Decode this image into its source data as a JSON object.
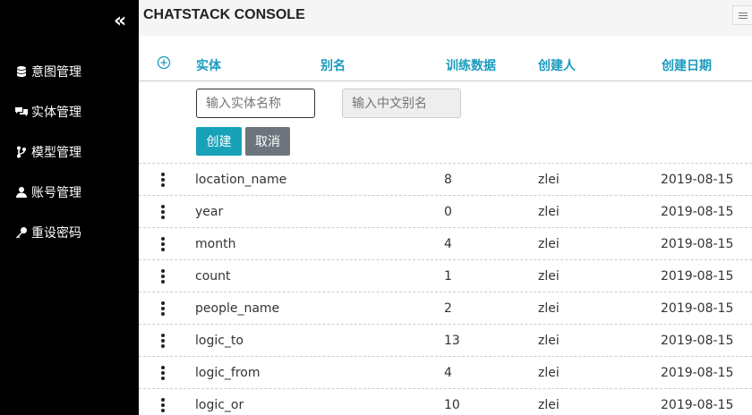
{
  "app": {
    "title": "CHATSTACK CONSOLE"
  },
  "sidebar": {
    "collapse_icon": "double-chevron-left-icon",
    "items": [
      {
        "label": "意图管理",
        "icon": "database-icon"
      },
      {
        "label": "实体管理",
        "icon": "chat-icon"
      },
      {
        "label": "模型管理",
        "icon": "branch-icon"
      },
      {
        "label": "账号管理",
        "icon": "user-icon"
      },
      {
        "label": "重设密码",
        "icon": "key-icon"
      }
    ]
  },
  "table": {
    "headers": [
      "实体",
      "别名",
      "训练数据",
      "创建人",
      "创建日期"
    ],
    "rows": [
      {
        "name": "location_name",
        "count": "8",
        "creator": "zlei",
        "date": "2019-08-15"
      },
      {
        "name": "year",
        "count": "0",
        "creator": "zlei",
        "date": "2019-08-15"
      },
      {
        "name": "month",
        "count": "4",
        "creator": "zlei",
        "date": "2019-08-15"
      },
      {
        "name": "count",
        "count": "1",
        "creator": "zlei",
        "date": "2019-08-15"
      },
      {
        "name": "people_name",
        "count": "2",
        "creator": "zlei",
        "date": "2019-08-15"
      },
      {
        "name": "logic_to",
        "count": "13",
        "creator": "zlei",
        "date": "2019-08-15"
      },
      {
        "name": "logic_from",
        "count": "4",
        "creator": "zlei",
        "date": "2019-08-15"
      },
      {
        "name": "logic_or",
        "count": "10",
        "creator": "zlei",
        "date": "2019-08-15"
      }
    ]
  },
  "form": {
    "entity_placeholder": "输入实体名称",
    "alias_placeholder": "输入中文别名",
    "create_label": "创建",
    "cancel_label": "取消"
  },
  "colors": {
    "accent": "#17a2b8",
    "header_text": "#1a9bbf",
    "sidebar_bg": "#000000"
  }
}
